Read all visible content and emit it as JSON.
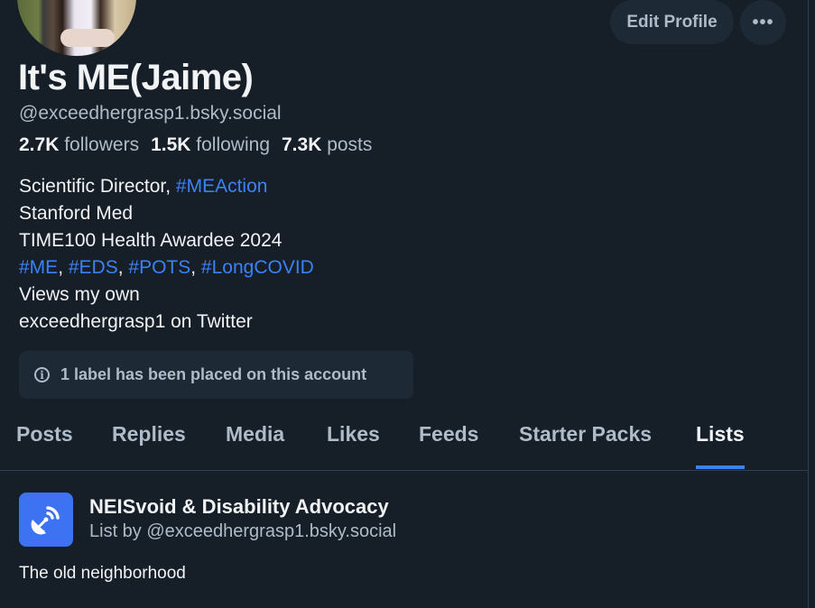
{
  "profile": {
    "display_name": "It's ME(Jaime)",
    "handle": "@exceedhergrasp1.bsky.social",
    "stats": {
      "followers_count": "2.7K",
      "followers_label": "followers",
      "following_count": "1.5K",
      "following_label": "following",
      "posts_count": "7.3K",
      "posts_label": "posts"
    },
    "bio": {
      "line1_text": "Scientific Director, ",
      "line1_tag": "#MEAction",
      "line2": "Stanford Med",
      "line3": "TIME100 Health Awardee 2024",
      "tags": [
        "#ME",
        "#EDS",
        "#POTS",
        "#LongCOVID"
      ],
      "separator": ", ",
      "line5": "Views my own",
      "line6": "exceedhergrasp1 on Twitter"
    },
    "label_notice": "1 label has been placed on this account",
    "avatar_icon": "user-avatar-photo"
  },
  "actions": {
    "edit_profile_label": "Edit Profile",
    "more_label": "•••"
  },
  "tabs": [
    {
      "label": "Posts",
      "active": false
    },
    {
      "label": "Replies",
      "active": false
    },
    {
      "label": "Media",
      "active": false
    },
    {
      "label": "Likes",
      "active": false
    },
    {
      "label": "Feeds",
      "active": false
    },
    {
      "label": "Starter Packs",
      "active": false
    },
    {
      "label": "Lists",
      "active": true
    }
  ],
  "lists": [
    {
      "title": "NEISvoid & Disability Advocacy",
      "byline": "List by @exceedhergrasp1.bsky.social",
      "description": "The old neighborhood",
      "icon": "satellite-dish-icon"
    }
  ],
  "colors": {
    "background": "#161e27",
    "surface": "#1e2936",
    "text_primary": "#f1f3f5",
    "text_secondary": "#aebbc9",
    "accent": "#3b82f6",
    "list_icon_bg": "#3d72f3"
  }
}
